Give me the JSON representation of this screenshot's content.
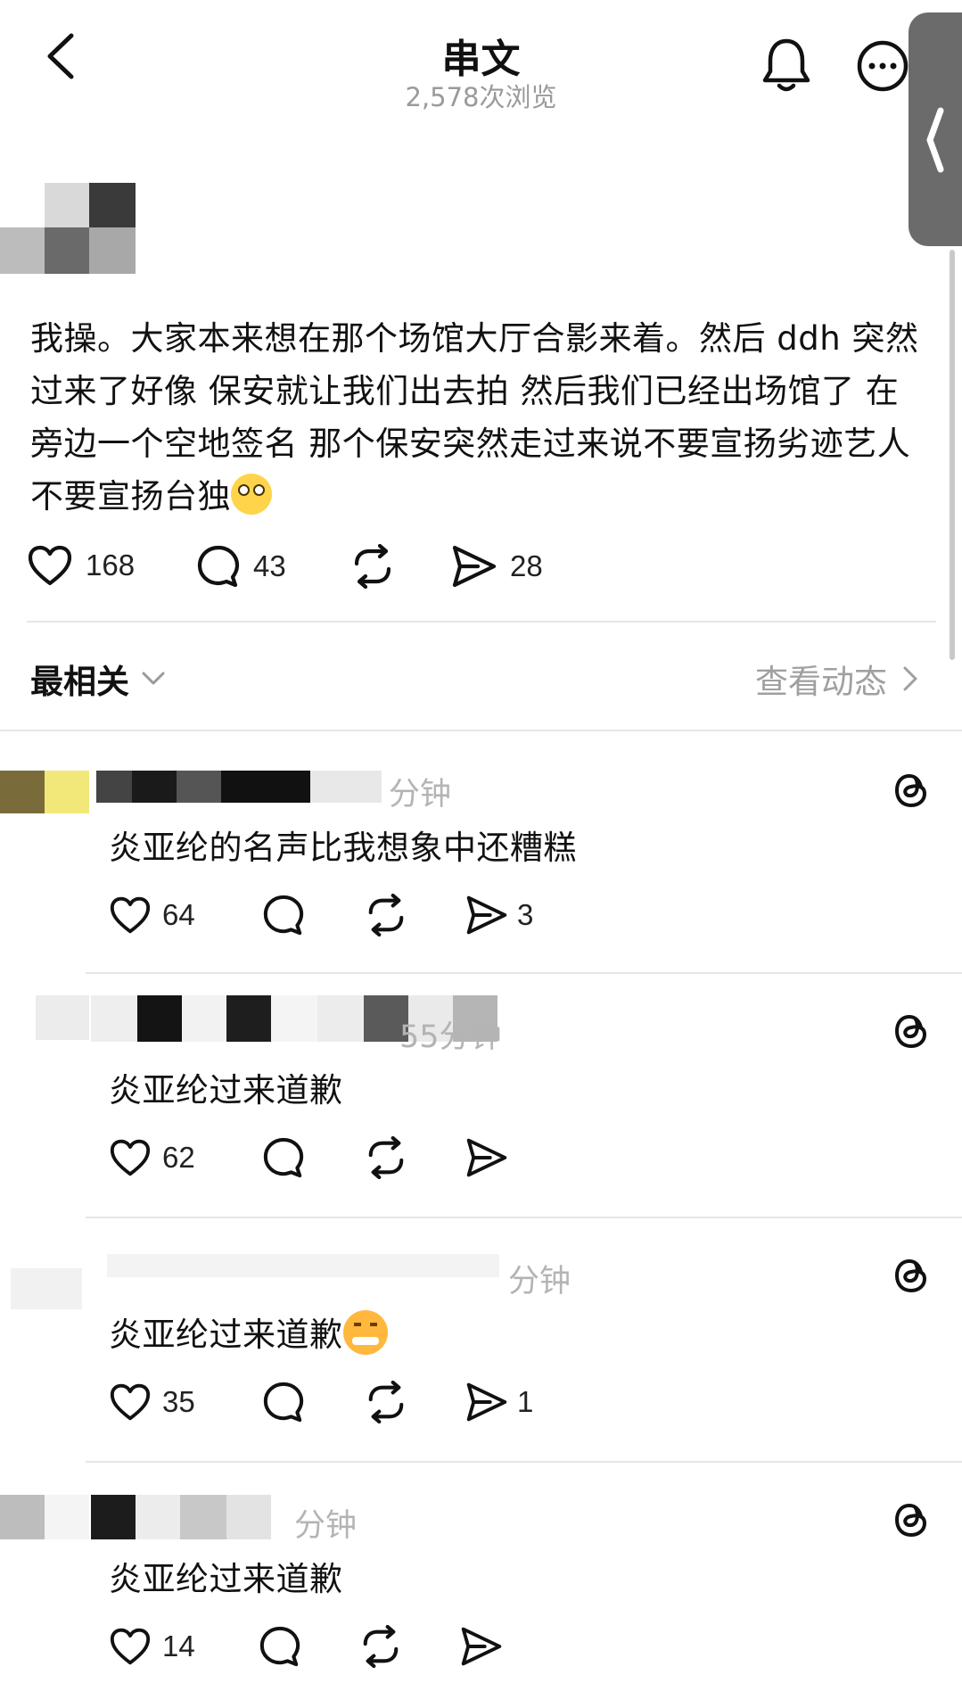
{
  "header": {
    "title": "串文",
    "views": "2,578次浏览"
  },
  "post": {
    "text": "我操。大家本来想在那个场馆大厅合影来着。然后 ddh 突然过来了好像 保安就让我们出去拍 然后我们已经出场馆了 在旁边一个空地签名 那个保安突然走过来说不要宣扬劣迹艺人 不要宣扬台独",
    "likes": "168",
    "comments": "43",
    "shares": "28"
  },
  "sort": {
    "label": "最相关",
    "activity_link": "查看动态"
  },
  "comments": [
    {
      "meta": "分钟",
      "text": "炎亚纶的名声比我想象中还糟糕",
      "likes": "64",
      "shares": "3"
    },
    {
      "meta": "55分钟",
      "text": "炎亚纶过来道歉",
      "likes": "62",
      "shares": ""
    },
    {
      "meta": "分钟",
      "text": "炎亚纶过来道歉",
      "likes": "35",
      "shares": "1"
    },
    {
      "meta": "分钟",
      "text": "炎亚纶过来道歉",
      "likes": "14",
      "shares": ""
    }
  ],
  "icons": {
    "back": "chevron-left-icon",
    "bell": "bell-icon",
    "more": "more-icon",
    "like": "heart-icon",
    "comment": "comment-icon",
    "repost": "repost-icon",
    "share": "share-icon",
    "threads": "threads-icon"
  }
}
